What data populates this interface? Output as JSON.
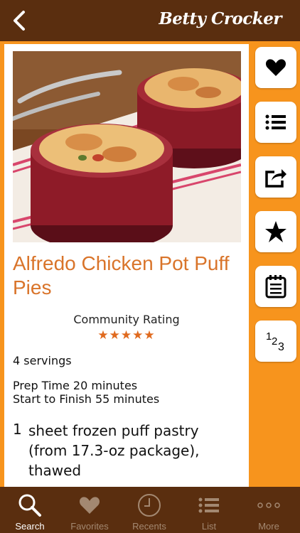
{
  "header": {
    "logo_text": "Betty Crocker",
    "back_icon": "chevron-left-icon"
  },
  "recipe": {
    "title": "Alfredo Chicken Pot Puff Pies",
    "rating_label": "Community Rating",
    "stars": "★★★★★",
    "rating_value": 5,
    "servings": "4 servings",
    "prep_time": "Prep Time 20 minutes",
    "start_to_finish": "Start to Finish 55 minutes",
    "ingredients": [
      {
        "qty": "1",
        "text": "sheet frozen puff pastry (from 17.3-oz package), thawed"
      }
    ]
  },
  "side_actions": [
    {
      "name": "favorite",
      "icon": "heart-icon"
    },
    {
      "name": "list",
      "icon": "list-icon"
    },
    {
      "name": "share",
      "icon": "share-icon"
    },
    {
      "name": "rate",
      "icon": "star-icon"
    },
    {
      "name": "calendar",
      "icon": "notepad-icon"
    },
    {
      "name": "numbers",
      "icon": "numbers-icon",
      "label": "123"
    }
  ],
  "tabs": [
    {
      "label": "Search",
      "icon": "search-icon",
      "active": true
    },
    {
      "label": "Favorites",
      "icon": "heart-icon",
      "active": false
    },
    {
      "label": "Recents",
      "icon": "clock-icon",
      "active": false
    },
    {
      "label": "List",
      "icon": "list-icon",
      "active": false
    },
    {
      "label": "More",
      "icon": "more-icon",
      "active": false
    }
  ],
  "colors": {
    "header_bg": "#5a2e0f",
    "page_bg": "#f7941d",
    "title": "#d9742a",
    "stars": "#e06a1e",
    "tab_active": "#ffffff",
    "tab_inactive": "#a38871"
  }
}
